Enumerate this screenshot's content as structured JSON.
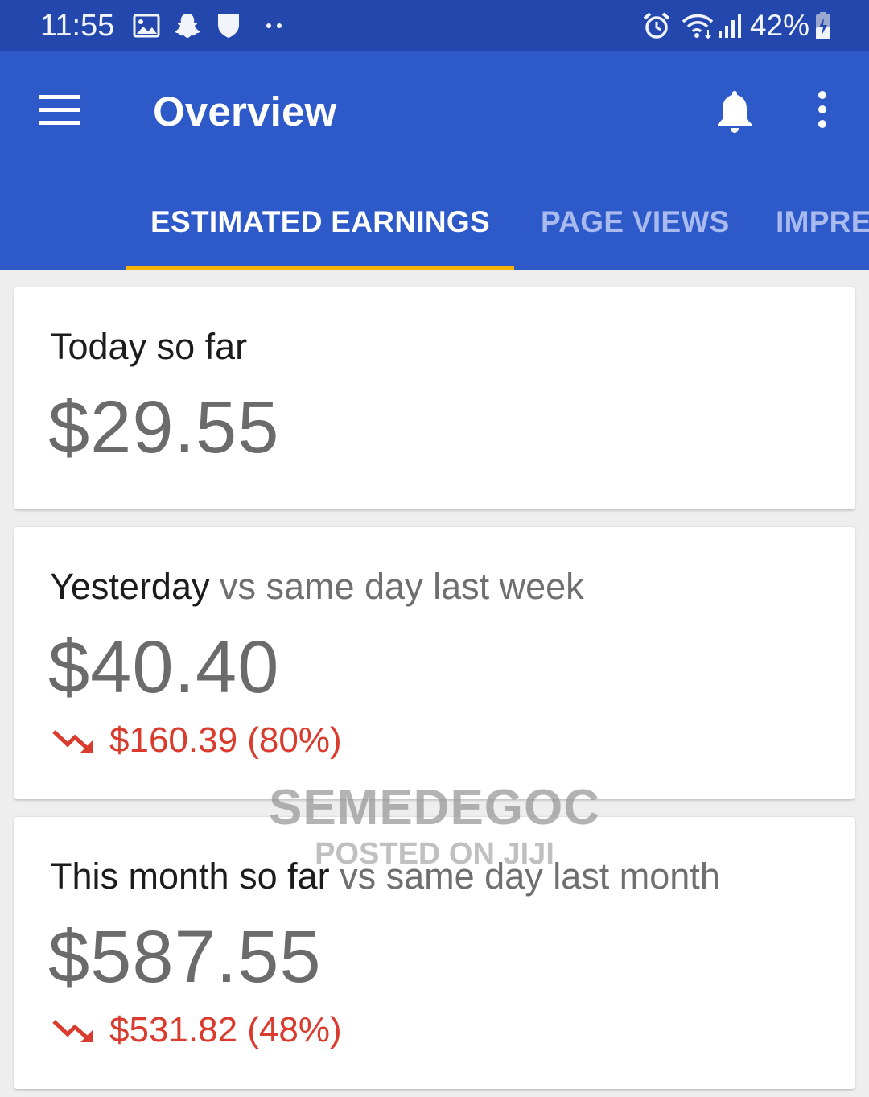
{
  "status_bar": {
    "time": "11:55",
    "battery": "42%",
    "left_icons": [
      "image-icon",
      "snapchat-icon",
      "shield-icon",
      "more-notifications-icon"
    ],
    "right_icons": [
      "alarm-icon",
      "wifi-icon",
      "signal-icon",
      "battery-charging-icon"
    ]
  },
  "app_bar": {
    "title": "Overview",
    "menu_icon": "hamburger-menu-icon",
    "notification_icon": "bell-icon",
    "overflow_icon": "more-vert-icon",
    "background_color": "#2d59c9"
  },
  "tabs": [
    {
      "label": "ESTIMATED EARNINGS",
      "active": true
    },
    {
      "label": "PAGE VIEWS",
      "active": false
    },
    {
      "label": "IMPRE",
      "active": false
    }
  ],
  "tab_indicator_color": "#f4b400",
  "cards": {
    "today": {
      "title": "Today so far",
      "value": "$29.55"
    },
    "yesterday": {
      "title": "Yesterday",
      "comparison": " vs same day last week",
      "value": "$40.40",
      "change": "$160.39 (80%)",
      "trend": "down"
    },
    "month": {
      "title": "This month so far",
      "comparison": " vs same day last month",
      "value": "$587.55",
      "change": "$531.82 (48%)",
      "trend": "down"
    }
  },
  "negative_color": "#d93c2e",
  "watermark": {
    "main": "SEMEDEGOC",
    "sub": "POSTED ON JIJI"
  }
}
